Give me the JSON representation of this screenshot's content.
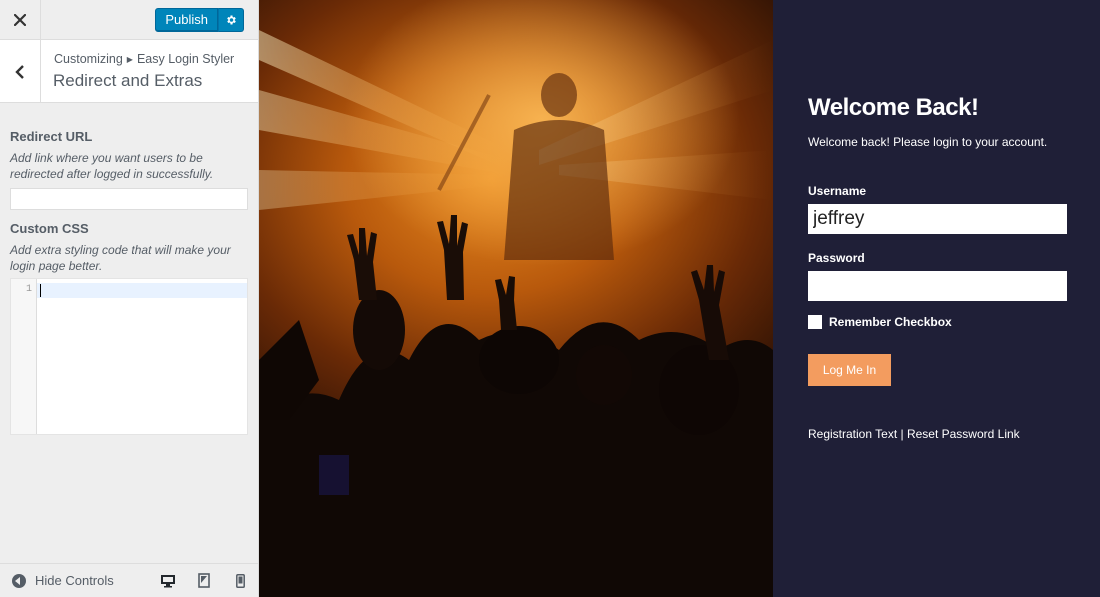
{
  "topbar": {
    "close_icon": "close-icon",
    "publish_label": "Publish",
    "settings_icon": "gear-icon"
  },
  "section": {
    "back_icon": "chevron-left-icon",
    "breadcrumb_root": "Customizing",
    "breadcrumb_parent": "Easy Login Styler",
    "title": "Redirect and Extras"
  },
  "redirect": {
    "title": "Redirect URL",
    "description": "Add link where you want users to be redirected after logged in successfully.",
    "value": ""
  },
  "custom_css": {
    "title": "Custom CSS",
    "description": "Add extra styling code that will make your login page better.",
    "line_number": "1"
  },
  "footer": {
    "hide_controls_label": "Hide Controls",
    "devices": [
      "desktop-icon",
      "tablet-icon",
      "mobile-icon"
    ]
  },
  "login": {
    "title": "Welcome Back!",
    "subtitle": "Welcome back! Please login to your account.",
    "username_label": "Username",
    "username_value": "jeffrey",
    "password_label": "Password",
    "password_value": "",
    "remember_label": "Remember Checkbox",
    "button_label": "Log Me In",
    "links_text": "Registration Text | Reset Password Link"
  },
  "colors": {
    "publish": "#0085ba",
    "panel_bg": "#1f1f37",
    "login_button": "#f39c5f"
  }
}
